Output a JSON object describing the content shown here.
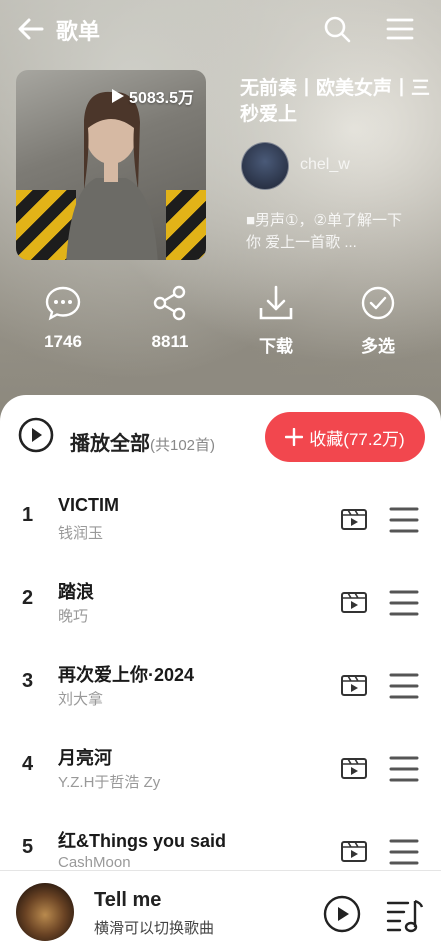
{
  "header": {
    "title": "歌单",
    "back_icon": "arrow-left-icon",
    "search_icon": "search-icon",
    "menu_icon": "hamburger-icon"
  },
  "playlist": {
    "play_count": "5083.5万",
    "name": "无前奏丨欧美女声丨三秒爱上",
    "creator": "chel_w",
    "description": "■男声①，②单了解一下 你 爱上一首歌 ..."
  },
  "actions": [
    {
      "icon": "comment-icon",
      "label": "1746"
    },
    {
      "icon": "share-icon",
      "label": "8811"
    },
    {
      "icon": "download-icon",
      "label": "下载"
    },
    {
      "icon": "multi-select-icon",
      "label": "多选"
    }
  ],
  "list_header": {
    "play_all": "播放全部",
    "count": "(共102首)",
    "collect": "收藏(77.2万)"
  },
  "songs": [
    {
      "index": "1",
      "name": "VICTIM",
      "artist": "钱润玉"
    },
    {
      "index": "2",
      "name": "踏浪",
      "artist": "晚巧"
    },
    {
      "index": "3",
      "name": "再次爱上你·2024",
      "artist": "刘大拿"
    },
    {
      "index": "4",
      "name": "月亮河",
      "artist": "Y.Z.H于哲浩  Zy"
    },
    {
      "index": "5",
      "name": "红&Things you said",
      "artist": "CashMoon"
    }
  ],
  "mini_player": {
    "title": "Tell me",
    "subtitle": "横滑可以切换歌曲"
  },
  "colors": {
    "accent": "#f2474e",
    "text_primary": "#222222",
    "text_secondary": "#999999"
  }
}
